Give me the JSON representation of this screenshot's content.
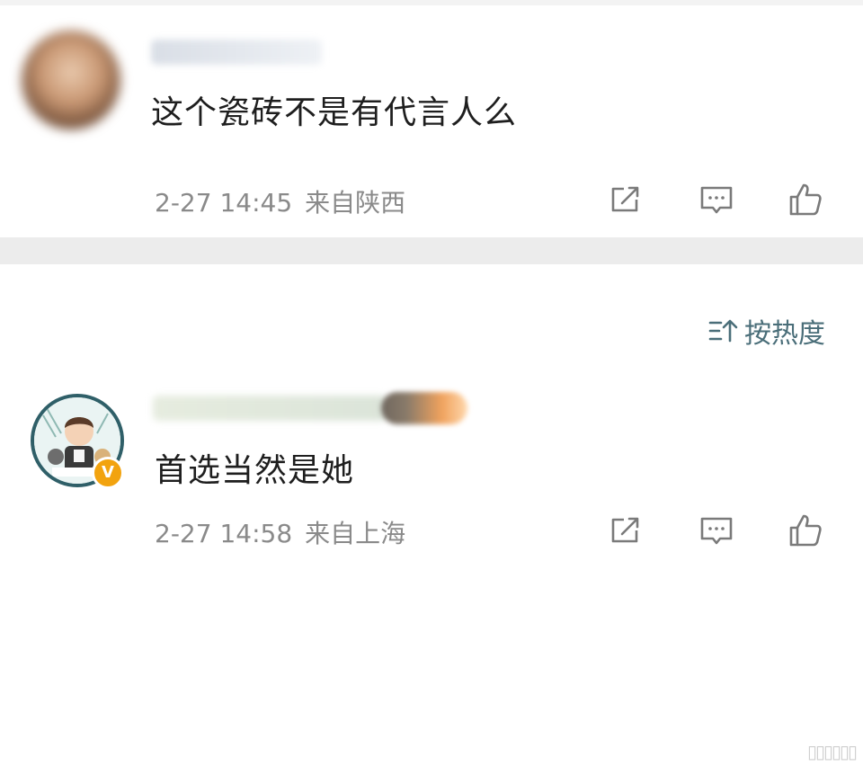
{
  "comments": [
    {
      "text": "这个瓷砖不是有代言人么",
      "time": "2-27 14:45",
      "location": "来自陕西"
    },
    {
      "text": "首选当然是她",
      "time": "2-27 14:58",
      "location": "来自上海"
    }
  ],
  "sort": {
    "label": "按热度",
    "icon": "sort-icon"
  },
  "actions": {
    "share_icon": "share-icon",
    "reply_icon": "comment-icon",
    "like_icon": "thumbs-up-icon"
  },
  "badge": {
    "verified_mark": "V"
  },
  "colors": {
    "meta_text": "#8a8a8a",
    "sort_accent": "#4a6e79",
    "divider": "#ececec",
    "verified": "#f2a30f"
  }
}
